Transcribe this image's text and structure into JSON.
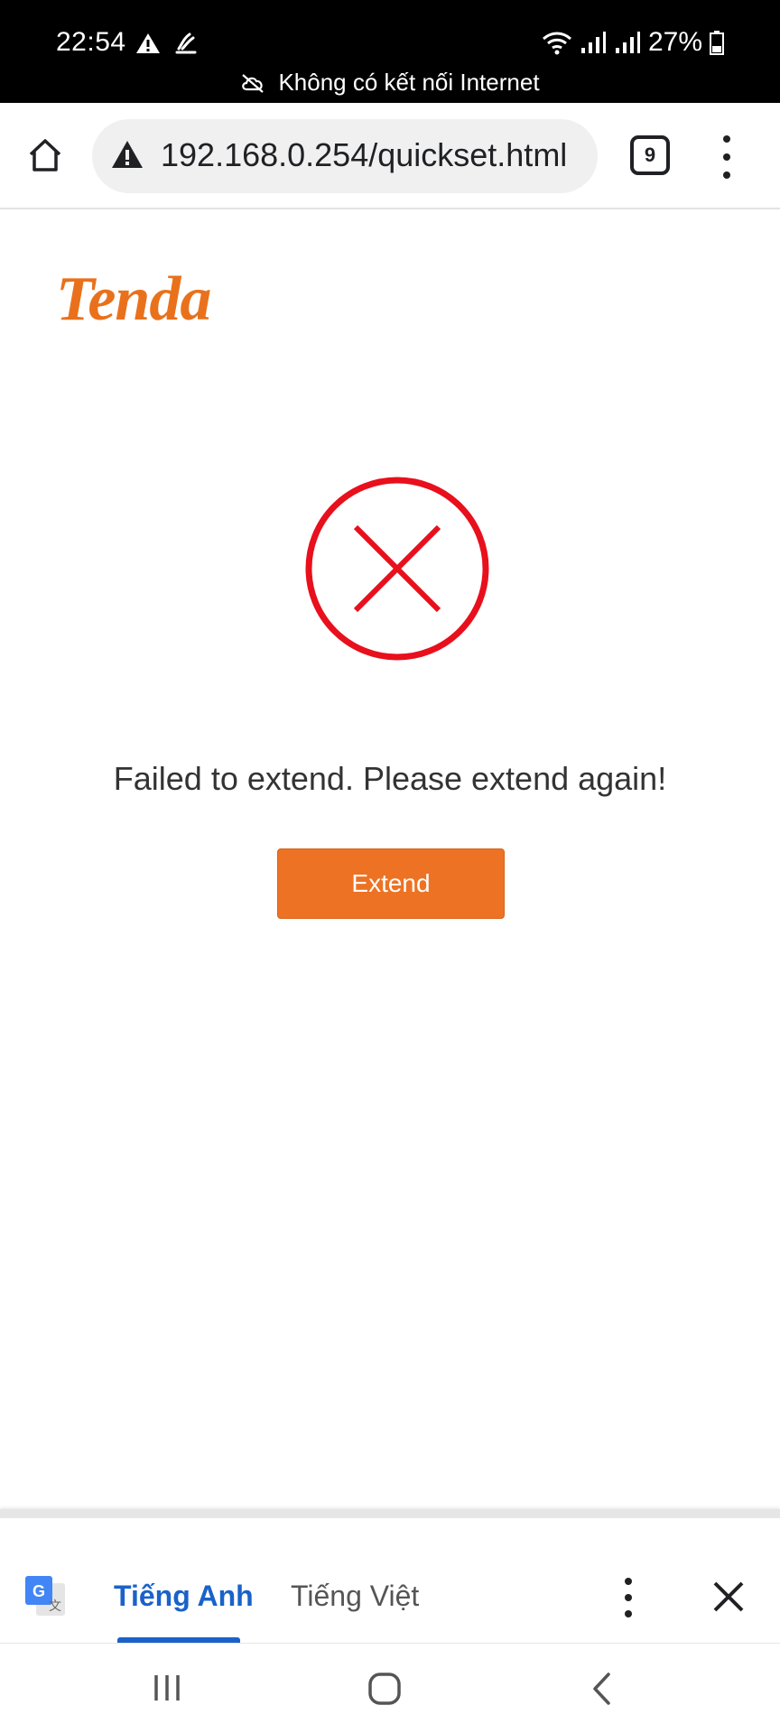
{
  "status_bar": {
    "time": "22:54",
    "battery": "27%",
    "connectivity_message": "Không có kết nối Internet"
  },
  "browser": {
    "url": "192.168.0.254/quickset.html",
    "tab_count": "9"
  },
  "page": {
    "logo": "Tenda",
    "error_message": "Failed to extend. Please extend again!",
    "extend_button_label": "Extend",
    "accent_color": "#ed7223",
    "error_color": "#e8101c"
  },
  "translate_bar": {
    "source_language": "Tiếng Anh",
    "target_language": "Tiếng Việt"
  },
  "icons": [
    "warning-icon",
    "signal-icon",
    "wifi-icon",
    "battery-icon",
    "cloud-off-icon",
    "home-icon",
    "tabs-icon",
    "more-menu-icon",
    "error-x-icon",
    "google-translate-icon",
    "close-icon",
    "recent-apps-icon",
    "nav-home-icon",
    "back-icon"
  ]
}
